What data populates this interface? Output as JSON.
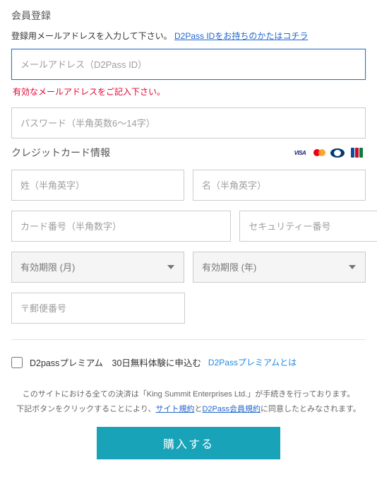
{
  "header": {
    "title": "会員登録",
    "subtitle_pre": "登録用メールアドレスを入力して下さい。",
    "subtitle_link": "D2Pass IDをお持ちのかたはコチラ"
  },
  "email": {
    "placeholder": "メールアドレス（D2Pass ID）",
    "value": "",
    "error": "有効なメールアドレスをご記入下さい。"
  },
  "password": {
    "placeholder": "パスワード（半角英数6～14字）",
    "value": ""
  },
  "cc": {
    "title": "クレジットカード情報",
    "last_name_placeholder": "姓（半角英字）",
    "first_name_placeholder": "名（半角英字）",
    "card_number_placeholder": "カード番号（半角数字）",
    "cvv_placeholder": "セキュリティー番号",
    "exp_month_placeholder": "有効期限 (月)",
    "exp_year_placeholder": "有効期限 (年)",
    "postal_placeholder": "〒郵便番号"
  },
  "premium": {
    "checkbox_label": "D2passプレミアム　30日無料体験に申込む",
    "link_label": "D2Passプレミアムとは"
  },
  "footer": {
    "line1": "このサイトにおける全ての決済は「King Summit Enterprises Ltd.」が手続きを行っております。",
    "line2_pre": "下記ボタンをクリックすることにより、",
    "link1": "サイト規約",
    "line2_mid": "と",
    "link2": "D2Pass会員規約",
    "line2_post": "に同意したとみなされます。"
  },
  "buy_label": "購入する",
  "icons": {
    "visa": "VISA"
  }
}
